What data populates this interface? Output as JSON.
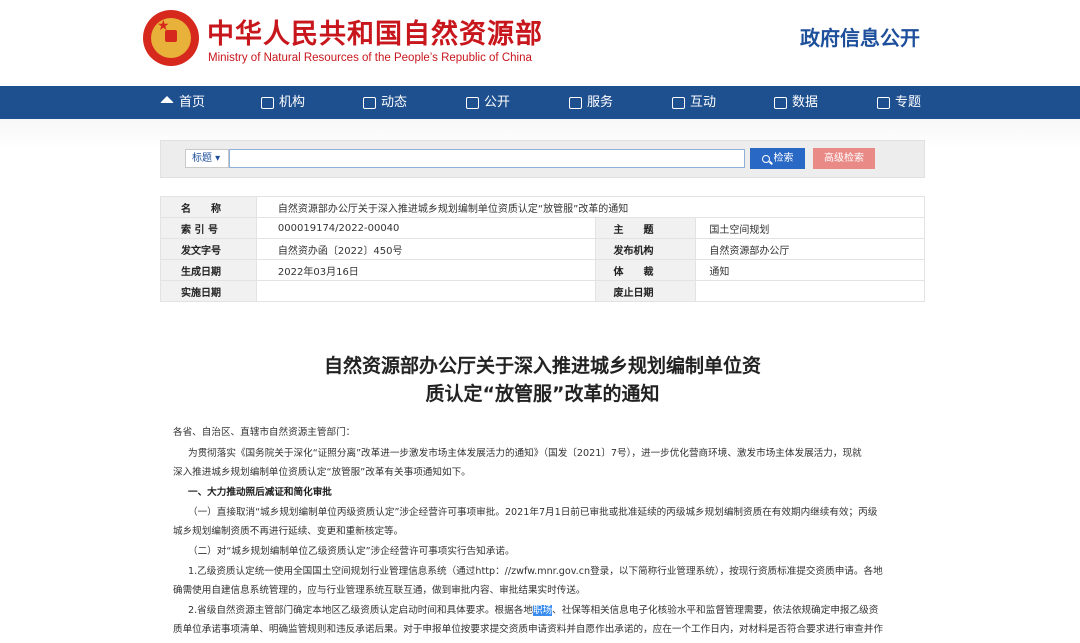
{
  "header": {
    "title": "中华人民共和国自然资源部",
    "subtitle": "Ministry of Natural Resources of the People’s Republic of China",
    "section": "政府信息公开"
  },
  "nav": [
    {
      "label": "首页",
      "icon": "home-icon"
    },
    {
      "label": "机构",
      "icon": "institution-icon"
    },
    {
      "label": "动态",
      "icon": "news-icon"
    },
    {
      "label": "公开",
      "icon": "disclosure-icon"
    },
    {
      "label": "服务",
      "icon": "service-icon"
    },
    {
      "label": "互动",
      "icon": "interaction-icon"
    },
    {
      "label": "数据",
      "icon": "data-icon"
    },
    {
      "label": "专题",
      "icon": "topic-icon"
    }
  ],
  "search": {
    "field_select": "标题",
    "input_value": "",
    "search_label": "检索",
    "advanced_label": "高级检索"
  },
  "meta": {
    "name_key": "名　　称",
    "name_value": "自然资源部办公厅关于深入推进城乡规划编制单位资质认定“放管服”改革的通知",
    "index_key": "索 引 号",
    "index_value": "000019174/2022-00040",
    "topic_key": "主　　题",
    "topic_value": "国土空间规划",
    "docno_key": "发文字号",
    "docno_value": "自然资办函〔2022〕450号",
    "issuer_key": "发布机构",
    "issuer_value": "自然资源部办公厅",
    "date_key": "生成日期",
    "date_value": "2022年03月16日",
    "genre_key": "体　　裁",
    "genre_value": "通知",
    "effective_key": "实施日期",
    "effective_value": "",
    "abolish_key": "废止日期",
    "abolish_value": ""
  },
  "article": {
    "title_line1": "自然资源部办公厅关于深入推进城乡规划编制单位资",
    "title_line2": "质认定“放管服”改革的通知",
    "salutation": "各省、自治区、直辖市自然资源主管部门：",
    "p1_l1": "为贯彻落实《国务院关于深化“证照分离”改革进一步激发市场主体发展活力的通知》（国发〔2021〕7号），进一步优化营商环境、激发市场主体发展活力，现就",
    "p1_l2": "深入推进城乡规划编制单位资质认定“放管服”改革有关事项通知如下。",
    "h1": "一、大力推动照后减证和简化审批",
    "p2_l1": "（一）直接取消“城乡规划编制单位丙级资质认定”涉企经营许可事项审批。2021年7月1日前已审批或批准延续的丙级城乡规划编制资质在有效期内继续有效；丙级",
    "p2_l2": "城乡规划编制资质不再进行延续、变更和重新核定等。",
    "p3": "（二）对“城乡规划编制单位乙级资质认定”涉企经营许可事项实行告知承诺。",
    "p4_l1": "1.乙级资质认定统一使用全国国土空间规划行业管理信息系统（通过http：//zwfw.mnr.gov.cn登录，以下简称行业管理系统），按现行资质标准提交资质申请。各地",
    "p4_l2": "确需使用自建信息系统管理的，应与行业管理系统互联互通，做到审批内容、审批结果实时传送。",
    "p5_l1_a": "2.省级自然资源主管部门确定本地区乙级资质认定启动时间和具体要求。根据各地",
    "p5_l1_hl": "职场",
    "p5_l1_b": "、社保等相关信息电子化核验水平和监督管理需要，依法依规确定申报乙级资",
    "p5_l2": "质单位承诺事项清单、明确监管规则和违反承诺后果。对于申报单位按要求提交资质申请资料并自愿作出承诺的，应在一个工作日内，对材料是否符合要求进行审查并作"
  }
}
